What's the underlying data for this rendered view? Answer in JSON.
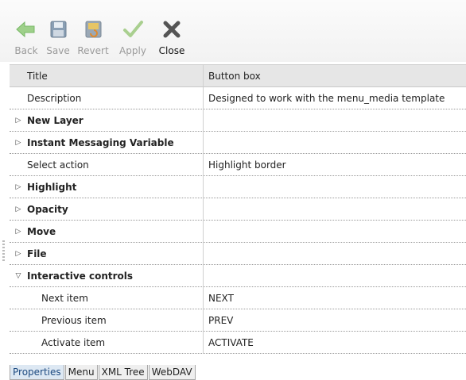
{
  "toolbar": {
    "back": "Back",
    "save": "Save",
    "revert": "Revert",
    "apply": "Apply",
    "close": "Close"
  },
  "grid": {
    "header": {
      "name": "Title",
      "value": "Button box"
    },
    "rows": [
      {
        "name": "Description",
        "value": "Designed to work with the menu_media template"
      },
      {
        "name": "New Layer",
        "value": ""
      },
      {
        "name": "Instant Messaging Variable",
        "value": ""
      },
      {
        "name": "Select action",
        "value": "Highlight border"
      },
      {
        "name": "Highlight",
        "value": ""
      },
      {
        "name": "Opacity",
        "value": ""
      },
      {
        "name": "Move",
        "value": ""
      },
      {
        "name": "File",
        "value": ""
      },
      {
        "name": "Interactive controls",
        "value": ""
      },
      {
        "name": "Next item",
        "value": "NEXT"
      },
      {
        "name": "Previous item",
        "value": "PREV"
      },
      {
        "name": "Activate item",
        "value": "ACTIVATE"
      }
    ]
  },
  "tabs": [
    "Properties",
    "Menu",
    "XML Tree",
    "WebDAV"
  ],
  "colors": {
    "accent_tab": "#dde8f3",
    "back_green": "#7cc35a",
    "close_gray": "#4a4a4a"
  }
}
